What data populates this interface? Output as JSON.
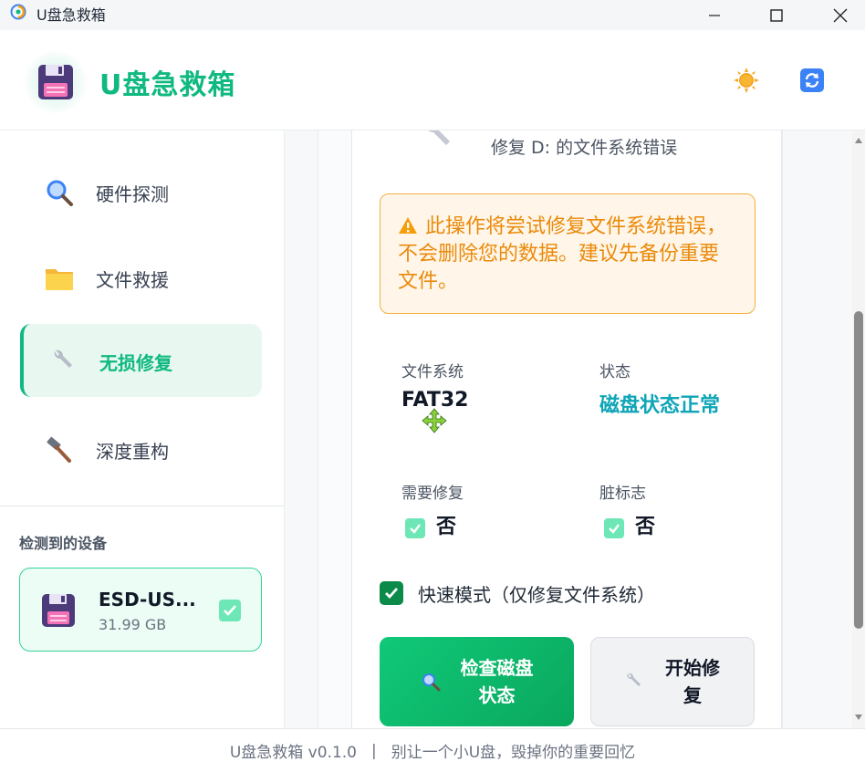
{
  "window": {
    "title": "U盘急救箱"
  },
  "header": {
    "brand": "U盘急救箱",
    "logo_icon": "floppy-disk-icon",
    "theme_icon": "sun-icon",
    "refresh_icon": "refresh-icon"
  },
  "sidebar": {
    "items": [
      {
        "label": "硬件探测",
        "icon": "magnifier-icon",
        "active": false
      },
      {
        "label": "文件救援",
        "icon": "folder-icon",
        "active": false
      },
      {
        "label": "无损修复",
        "icon": "wrench-icon",
        "active": true
      },
      {
        "label": "深度重构",
        "icon": "hammer-icon",
        "active": false
      }
    ],
    "devices_title": "检测到的设备",
    "device": {
      "name": "ESD-US...",
      "size": "31.99 GB",
      "selected": true
    }
  },
  "main": {
    "subtitle": "修复 D: 的文件系统错误",
    "warning": "此操作将尝试修复文件系统错误，不会删除您的数据。建议先备份重要文件。",
    "info": {
      "fs_label": "文件系统",
      "fs_value": "FAT32",
      "status_label": "状态",
      "status_value": "磁盘状态正常",
      "needs_repair_label": "需要修复",
      "needs_repair_value": "否",
      "dirty_label": "脏标志",
      "dirty_value": "否"
    },
    "quick_mode": {
      "label": "快速模式（仅修复文件系统）",
      "checked": true
    },
    "buttons": {
      "check_line1": "检查磁盘",
      "check_line2": "状态",
      "repair_line1": "开始修",
      "repair_line2": "复"
    }
  },
  "footer": {
    "version": "U盘急救箱 v0.1.0",
    "separator": "|",
    "slogan": "别让一个小U盘，毁掉你的重要回忆"
  },
  "colors": {
    "accent": "#10b981",
    "warning_text": "#ea8a0b",
    "status_teal": "#0ea5b7"
  }
}
